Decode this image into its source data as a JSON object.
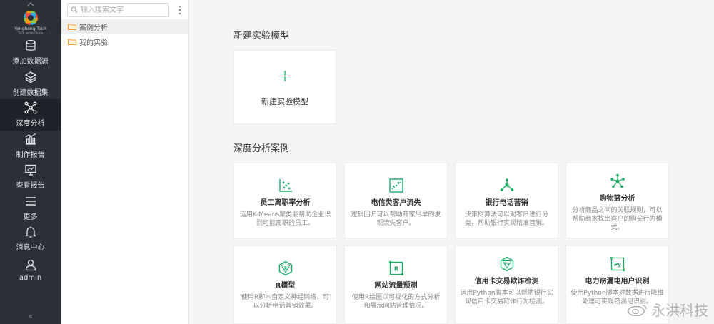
{
  "brand": {
    "name": "Yonghong Tech",
    "tagline": "Talk with Data"
  },
  "nav": {
    "items": [
      {
        "label": "添加数据源",
        "icon": "database-icon"
      },
      {
        "label": "创建数据集",
        "icon": "layers-icon"
      },
      {
        "label": "深度分析",
        "icon": "network-icon",
        "active": true
      },
      {
        "label": "制作报告",
        "icon": "bar-chart-icon"
      },
      {
        "label": "查看报告",
        "icon": "monitor-icon"
      },
      {
        "label": "更多",
        "icon": "menu-icon"
      },
      {
        "label": "消息中心",
        "icon": "bell-icon"
      },
      {
        "label": "admin",
        "icon": "user-icon"
      }
    ],
    "collapse_glyph": "«"
  },
  "tree": {
    "search_placeholder": "输入搜索文字",
    "items": [
      {
        "label": "案例分析",
        "selected": true
      },
      {
        "label": "我的实验",
        "selected": false
      }
    ]
  },
  "main": {
    "new_section_title": "新建实验模型",
    "new_card_label": "新建实验模型",
    "new_card_plus": "+",
    "cases_section_title": "深度分析案例",
    "cases": [
      {
        "title": "员工离职率分析",
        "desc": "运用K-Means聚类能帮助企业识别可能离职的员工。",
        "icon": "scatter-icon"
      },
      {
        "title": "电信类客户流失",
        "desc": "逻辑回归可以帮助商家尽早的发现流失客户。",
        "icon": "trend-icon"
      },
      {
        "title": "银行电话营销",
        "desc": "决策树算法可以对客户进行分类，帮助银行实现精准营销。",
        "icon": "tree-icon"
      },
      {
        "title": "购物篮分析",
        "desc": "分析商品之间的关联规则，可以帮助商家找出客户的购买行为模式。",
        "icon": "star-network-icon"
      },
      {
        "title": "R模型",
        "desc": "使用R脚本自定义神经网络，可以分析电话营销效果。",
        "icon": "r-hex-icon"
      },
      {
        "title": "网站流量预测",
        "desc": "使用R绘图以可视化的方式分析和展示网站管理情况。",
        "icon": "r-square-icon"
      },
      {
        "title": "信用卡交易欺诈检测",
        "desc": "运用Python脚本可以帮助银行实现信用卡交易欺诈行为检测。",
        "icon": "py-hex-icon"
      },
      {
        "title": "电力窃漏电用户识别",
        "desc": "使用Python脚本对数据进行降维处理可实现窃漏电识别。",
        "icon": "py-square-icon"
      }
    ]
  },
  "watermark": {
    "text": "永洪科技"
  },
  "colors": {
    "accent": "#1aae66",
    "nav_bg": "#2b2f36",
    "nav_active": "#1f2228"
  }
}
